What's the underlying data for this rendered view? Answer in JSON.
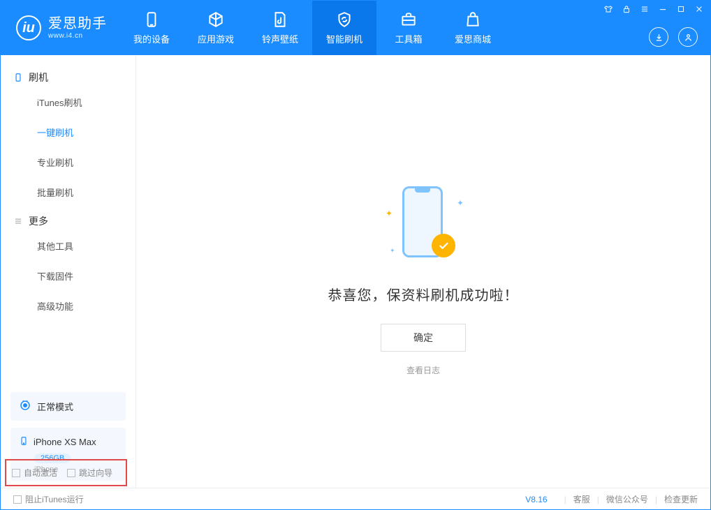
{
  "app": {
    "title": "爱思助手",
    "subtitle": "www.i4.cn"
  },
  "nav": {
    "items": [
      {
        "label": "我的设备"
      },
      {
        "label": "应用游戏"
      },
      {
        "label": "铃声壁纸"
      },
      {
        "label": "智能刷机"
      },
      {
        "label": "工具箱"
      },
      {
        "label": "爱思商城"
      }
    ],
    "active_index": 3
  },
  "sidebar": {
    "group1_label": "刷机",
    "group1_items": [
      {
        "label": "iTunes刷机"
      },
      {
        "label": "一键刷机"
      },
      {
        "label": "专业刷机"
      },
      {
        "label": "批量刷机"
      }
    ],
    "group1_active_index": 1,
    "group2_label": "更多",
    "group2_items": [
      {
        "label": "其他工具"
      },
      {
        "label": "下载固件"
      },
      {
        "label": "高级功能"
      }
    ],
    "mode_label": "正常模式",
    "device": {
      "name": "iPhone XS Max",
      "storage": "256GB",
      "type": "iPhone"
    },
    "footer_checks": {
      "auto_activate": "自动激活",
      "skip_guide": "跳过向导"
    }
  },
  "main": {
    "success_text": "恭喜您，保资料刷机成功啦！",
    "ok_button": "确定",
    "view_log": "查看日志"
  },
  "statusbar": {
    "block_itunes": "阻止iTunes运行",
    "version": "V8.16",
    "support": "客服",
    "wechat": "微信公众号",
    "check_update": "检查更新"
  }
}
